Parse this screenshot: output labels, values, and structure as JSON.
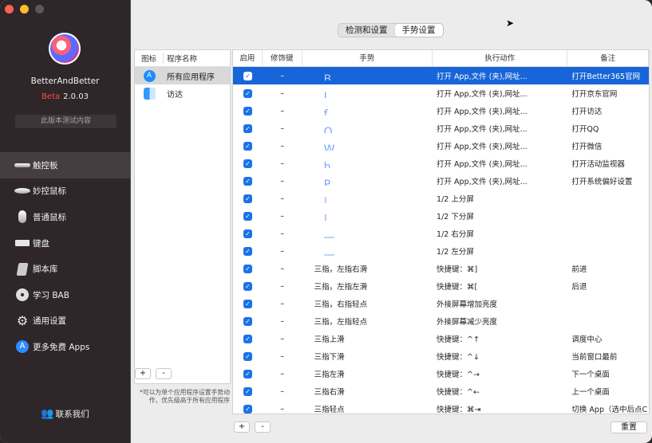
{
  "app": {
    "name": "BetterAndBetter",
    "beta": "Beta",
    "version": "2.0.03",
    "test_notice": "此版本测试内容"
  },
  "nav": [
    {
      "label": "触控板",
      "icon": "trackpad-icon"
    },
    {
      "label": "妙控鼠标",
      "icon": "magic-mouse-icon"
    },
    {
      "label": "普通鼠标",
      "icon": "mouse-icon"
    },
    {
      "label": "键盘",
      "icon": "keyboard-icon"
    },
    {
      "label": "脚本库",
      "icon": "script-icon"
    },
    {
      "label": "学习 BAB",
      "icon": "disc-icon"
    },
    {
      "label": "通用设置",
      "icon": "gear-icon"
    },
    {
      "label": "更多免费 Apps",
      "icon": "app-store-icon"
    }
  ],
  "contact": "联系我们",
  "tabs": {
    "detect": "检测和设置",
    "gesture": "手势设置"
  },
  "programs": {
    "col_icon": "图标",
    "col_name": "程序名称",
    "items": [
      {
        "name": "所有应用程序"
      },
      {
        "name": "访达"
      }
    ],
    "note": "*可以为单个应用程序设置手势动作，优先级高于所有应用程序"
  },
  "table": {
    "headers": [
      "启用",
      "修饰键",
      "手势",
      "执行动作",
      "备注"
    ],
    "rows": [
      {
        "mod": "–",
        "gesture": "",
        "glyph": "B",
        "action": "打开 App,文件 (夹),网址...",
        "memo": "打开Better365官网"
      },
      {
        "mod": "–",
        "gesture": "",
        "glyph": "J",
        "action": "打开 App,文件 (夹),网址...",
        "memo": "打开京东官网"
      },
      {
        "mod": "–",
        "gesture": "",
        "glyph": "f",
        "action": "打开 App,文件 (夹),网址...",
        "memo": "打开访达"
      },
      {
        "mod": "–",
        "gesture": "",
        "glyph": "Q",
        "action": "打开 App,文件 (夹),网址...",
        "memo": "打开QQ"
      },
      {
        "mod": "–",
        "gesture": "",
        "glyph": "W",
        "action": "打开 App,文件 (夹),网址...",
        "memo": "打开微信"
      },
      {
        "mod": "–",
        "gesture": "",
        "glyph": "h",
        "action": "打开 App,文件 (夹),网址...",
        "memo": "打开活动监视器"
      },
      {
        "mod": "–",
        "gesture": "",
        "glyph": "P",
        "action": "打开 App,文件 (夹),网址...",
        "memo": "打开系统偏好设置"
      },
      {
        "mod": "–",
        "gesture": "",
        "glyph": "|",
        "action": "1/2 上分屏",
        "memo": ""
      },
      {
        "mod": "–",
        "gesture": "",
        "glyph": "|",
        "action": "1/2 下分屏",
        "memo": ""
      },
      {
        "mod": "–",
        "gesture": "",
        "glyph": "—",
        "action": "1/2 右分屏",
        "memo": ""
      },
      {
        "mod": "–",
        "gesture": "",
        "glyph": "—",
        "action": "1/2 左分屏",
        "memo": ""
      },
      {
        "mod": "–",
        "gesture": "三指，左指右滑",
        "glyph": "",
        "action": "快捷键：⌘]",
        "memo": "前进"
      },
      {
        "mod": "–",
        "gesture": "三指，左指左滑",
        "glyph": "",
        "action": "快捷键：⌘[",
        "memo": "后退"
      },
      {
        "mod": "–",
        "gesture": "三指，右指轻点",
        "glyph": "",
        "action": "外接屏幕增加亮度",
        "memo": ""
      },
      {
        "mod": "–",
        "gesture": "三指，左指轻点",
        "glyph": "",
        "action": "外接屏幕减少亮度",
        "memo": ""
      },
      {
        "mod": "–",
        "gesture": "三指上滑",
        "glyph": "",
        "action": "快捷键：^↑",
        "memo": "调度中心"
      },
      {
        "mod": "–",
        "gesture": "三指下滑",
        "glyph": "",
        "action": "快捷键：^↓",
        "memo": "当前窗口最前"
      },
      {
        "mod": "–",
        "gesture": "三指左滑",
        "glyph": "",
        "action": "快捷键：^→",
        "memo": "下一个桌面"
      },
      {
        "mod": "–",
        "gesture": "三指右滑",
        "glyph": "",
        "action": "快捷键：^←",
        "memo": "上一个桌面"
      },
      {
        "mod": "–",
        "gesture": "三指轻点",
        "glyph": "",
        "action": "快捷键：⌘⇥",
        "memo": "切换 App（选中后点C"
      }
    ]
  },
  "buttons": {
    "add": "+",
    "remove": "-",
    "reset": "重置"
  }
}
